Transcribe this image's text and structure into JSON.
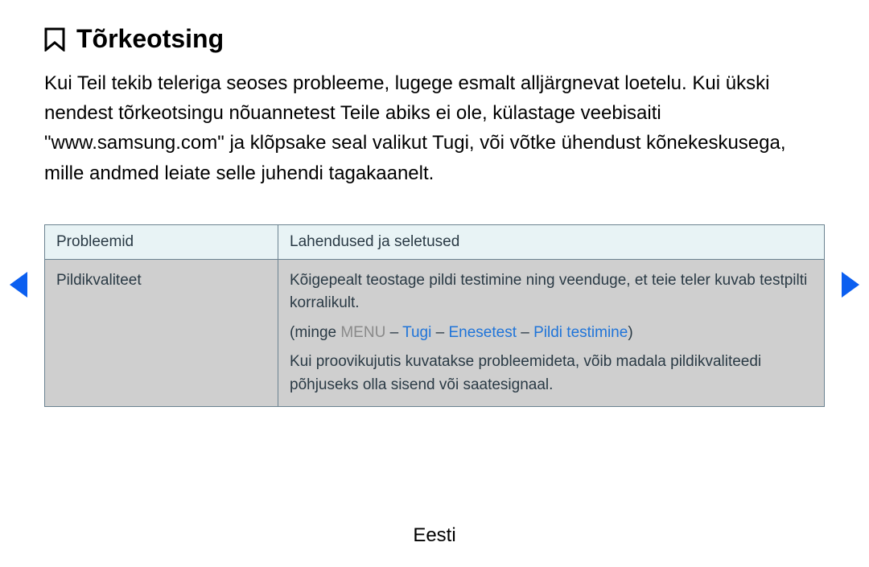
{
  "title": "Tõrkeotsing",
  "intro": "Kui Teil tekib teleriga seoses probleeme, lugege esmalt alljärgnevat loetelu. Kui ükski nendest tõrkeotsingu nõuannetest Teile abiks ei ole, külastage veebisaiti \"www.samsung.com\" ja klõpsake seal valikut Tugi, või võtke ühendust kõnekeskusega, mille andmed leiate selle juhendi tagakaanelt.",
  "table": {
    "headers": {
      "col1": "Probleemid",
      "col2": "Lahendused ja seletused"
    },
    "row": {
      "col1": "Pildikvaliteet",
      "para1": "Kõigepealt teostage pildi testimine ning veenduge, et teie teler kuvab testpilti korralikult.",
      "menu": {
        "open": "(minge ",
        "m1": "MENU",
        "sep1": " – ",
        "m2": "Tugi",
        "sep2": " – ",
        "m3": "Enesetest",
        "sep3": " – ",
        "m4": "Pildi testimine",
        "close": ")"
      },
      "para2": "Kui proovikujutis kuvatakse probleemideta, võib madala pildikvaliteedi põhjuseks olla sisend või saatesignaal."
    }
  },
  "footer": "Eesti"
}
